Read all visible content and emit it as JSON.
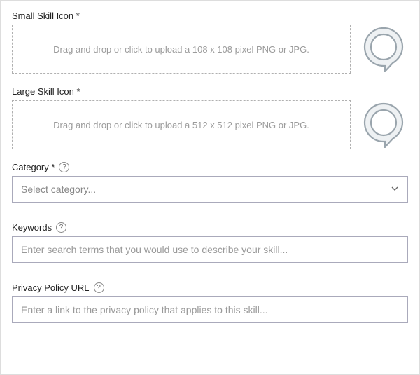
{
  "smallIcon": {
    "label": "Small Skill Icon *",
    "dropText": "Drag and drop or click to upload a 108 x 108 pixel PNG or JPG."
  },
  "largeIcon": {
    "label": "Large Skill Icon *",
    "dropText": "Drag and drop or click to upload a 512 x 512 pixel PNG or JPG."
  },
  "category": {
    "label": "Category *",
    "placeholder": "Select category..."
  },
  "keywords": {
    "label": "Keywords",
    "placeholder": "Enter search terms that you would use to describe your skill..."
  },
  "privacy": {
    "label": "Privacy Policy URL",
    "placeholder": "Enter a link to the privacy policy that applies to this skill..."
  },
  "help": "?"
}
